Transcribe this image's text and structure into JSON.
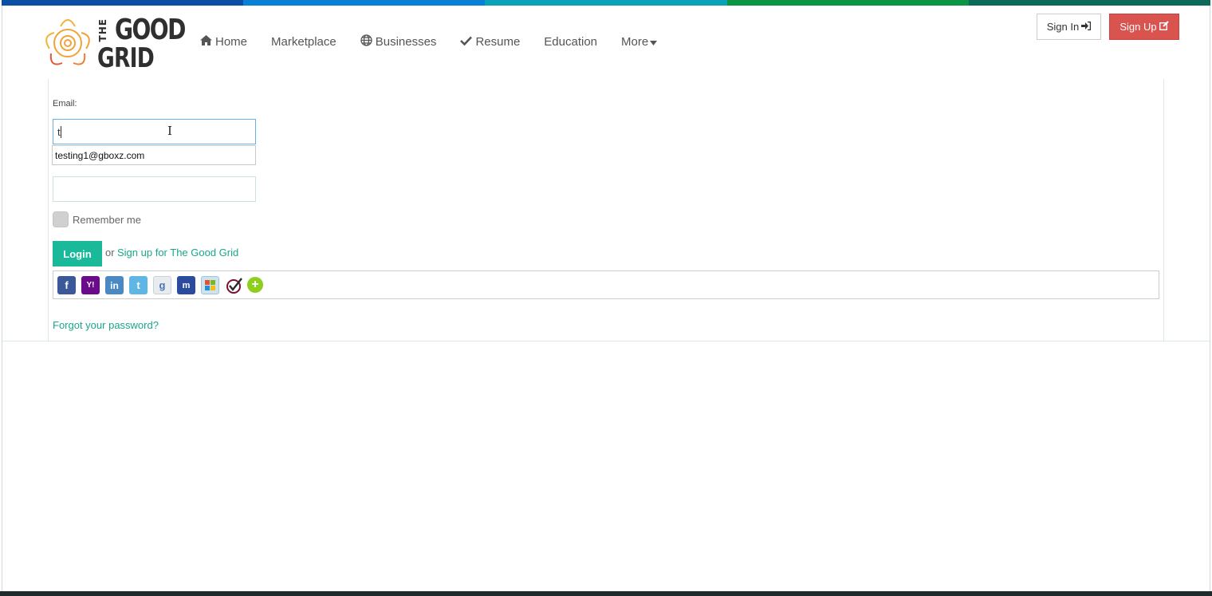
{
  "topbar": {
    "colors": [
      "#0a4fa3",
      "#0a7fd6",
      "#0ba2b8",
      "#0a9642",
      "#0b6a5a"
    ]
  },
  "logo": {
    "the": "THE",
    "good": "GOOD",
    "grid": "GRID",
    "icon": "flower-logo-icon"
  },
  "nav": {
    "items": [
      {
        "label": "Home",
        "icon": "home-icon"
      },
      {
        "label": "Marketplace",
        "icon": ""
      },
      {
        "label": "Businesses",
        "icon": "globe-icon"
      },
      {
        "label": "Resume",
        "icon": "check-icon"
      },
      {
        "label": "Education",
        "icon": ""
      },
      {
        "label": "More",
        "icon": "caret-down-icon"
      }
    ]
  },
  "auth": {
    "signin_label": "Sign In",
    "signup_label": "Sign Up"
  },
  "login_form": {
    "email_label": "Email:",
    "email_value": "t",
    "suggestion": "testing1@gboxz.com",
    "password_value": "",
    "remember_label": "Remember me",
    "login_button": "Login",
    "or_text": "or",
    "signup_link": "Sign up for The Good Grid",
    "forgot_link": "Forgot your password?"
  },
  "social": [
    {
      "name": "facebook-icon",
      "glyph": "f",
      "color": "#3b5998"
    },
    {
      "name": "yahoo-icon",
      "glyph": "Y!",
      "color": "#6b0a8a"
    },
    {
      "name": "linkedin-icon",
      "glyph": "in",
      "color": "#4a8ac4"
    },
    {
      "name": "twitter-icon",
      "glyph": "t",
      "color": "#5eb6e4"
    },
    {
      "name": "google-icon",
      "glyph": "g",
      "color": "#e8ecef"
    },
    {
      "name": "myspace-icon",
      "glyph": "m",
      "color": "#2b4c9e"
    },
    {
      "name": "windows-live-icon",
      "glyph": "▦",
      "color": "#9cc4dc"
    },
    {
      "name": "verisign-icon",
      "glyph": "✓",
      "color": "#ffffff"
    },
    {
      "name": "add-more-icon",
      "glyph": "+",
      "color": "#8ccf1c"
    }
  ]
}
